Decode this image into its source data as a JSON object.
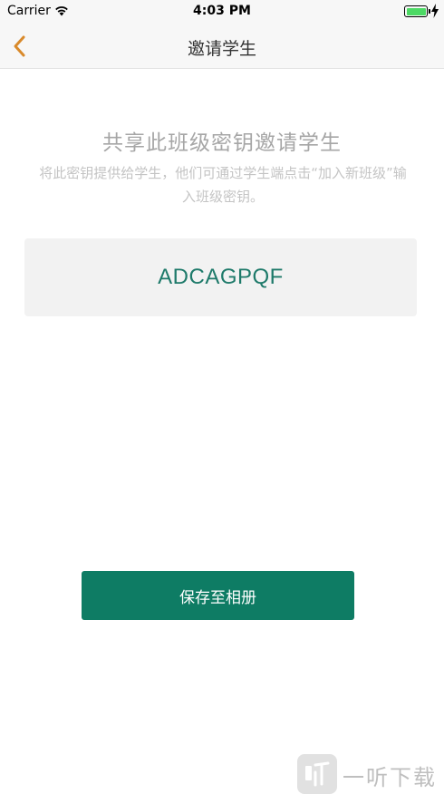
{
  "status_bar": {
    "carrier": "Carrier",
    "time": "4:03 PM",
    "battery_level": 1.0,
    "battery_color": "#4cd964"
  },
  "nav": {
    "back_icon": "chevron-left-icon",
    "title": "邀请学生",
    "accent": "#d98a2b"
  },
  "content": {
    "headline": "共享此班级密钥邀请学生",
    "description": "将此密钥提供给学生，他们可通过学生端点击“加入新班级”输入班级密钥。",
    "class_key": "ADCAGPQF"
  },
  "actions": {
    "save_label": "保存至相册",
    "button_color": "#0e7c64"
  },
  "watermark": {
    "text": "一听下载"
  }
}
